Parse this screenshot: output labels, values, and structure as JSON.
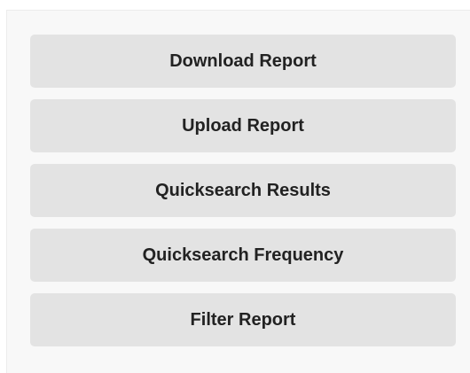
{
  "reports_menu": {
    "buttons": [
      {
        "label": "Download Report"
      },
      {
        "label": "Upload Report"
      },
      {
        "label": "Quicksearch Results"
      },
      {
        "label": "Quicksearch Frequency"
      },
      {
        "label": "Filter Report"
      }
    ]
  },
  "colors": {
    "panel_background": "#f8f8f8",
    "button_background": "#e3e3e3",
    "button_text": "#222222"
  }
}
